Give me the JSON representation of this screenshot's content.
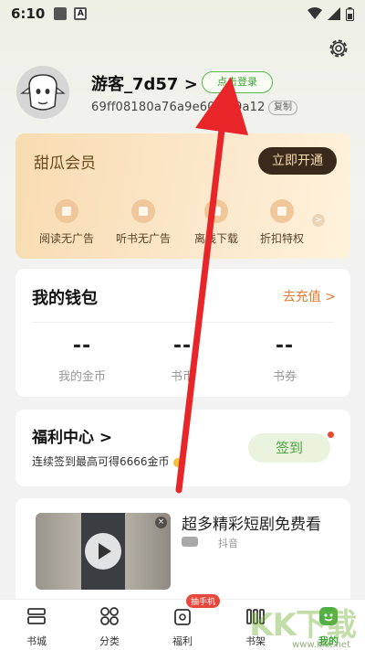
{
  "status_bar": {
    "time": "6:10",
    "a_icon": "A"
  },
  "profile": {
    "username": "游客_7d57",
    "login_button": "点击登录",
    "user_id": "69ff08180a76a9e6005",
    "user_id_tail": "9a12",
    "copy_label": "复制"
  },
  "vip": {
    "title": "甜瓜会员",
    "open_button": "立即开通",
    "perks": [
      {
        "label": "阅读无广告",
        "icon": "no-ads-icon"
      },
      {
        "label": "听书无广告",
        "icon": "headphones-icon"
      },
      {
        "label": "离线下载",
        "icon": "download-icon"
      },
      {
        "label": "折扣特权",
        "icon": "discount-icon"
      }
    ]
  },
  "wallet": {
    "title": "我的钱包",
    "recharge": "去充值",
    "items": [
      {
        "value": "--",
        "label": "我的金币"
      },
      {
        "value": "--",
        "label": "书币"
      },
      {
        "value": "--",
        "label": "书券"
      }
    ]
  },
  "welfare": {
    "title": "福利中心",
    "subtitle": "连续签到最高可得6666金币",
    "signin_button": "签到"
  },
  "drama": {
    "title": "超多精彩短剧免费看",
    "source": "抖音"
  },
  "tabbar": {
    "tabs": [
      {
        "label": "书城",
        "icon": "bookstore-icon"
      },
      {
        "label": "分类",
        "icon": "category-icon"
      },
      {
        "label": "福利",
        "icon": "welfare-icon",
        "badge": "抽手机"
      },
      {
        "label": "书架",
        "icon": "bookshelf-icon"
      },
      {
        "label": "我的",
        "icon": "mine-icon",
        "active": true
      }
    ]
  },
  "watermark": {
    "text": "KK下载",
    "url": "www.kkx.net"
  },
  "colors": {
    "accent_green": "#3da535",
    "vip_dark": "#3b2a1b",
    "arrow_red": "#e8262a",
    "recharge_orange": "#e37a2c"
  }
}
